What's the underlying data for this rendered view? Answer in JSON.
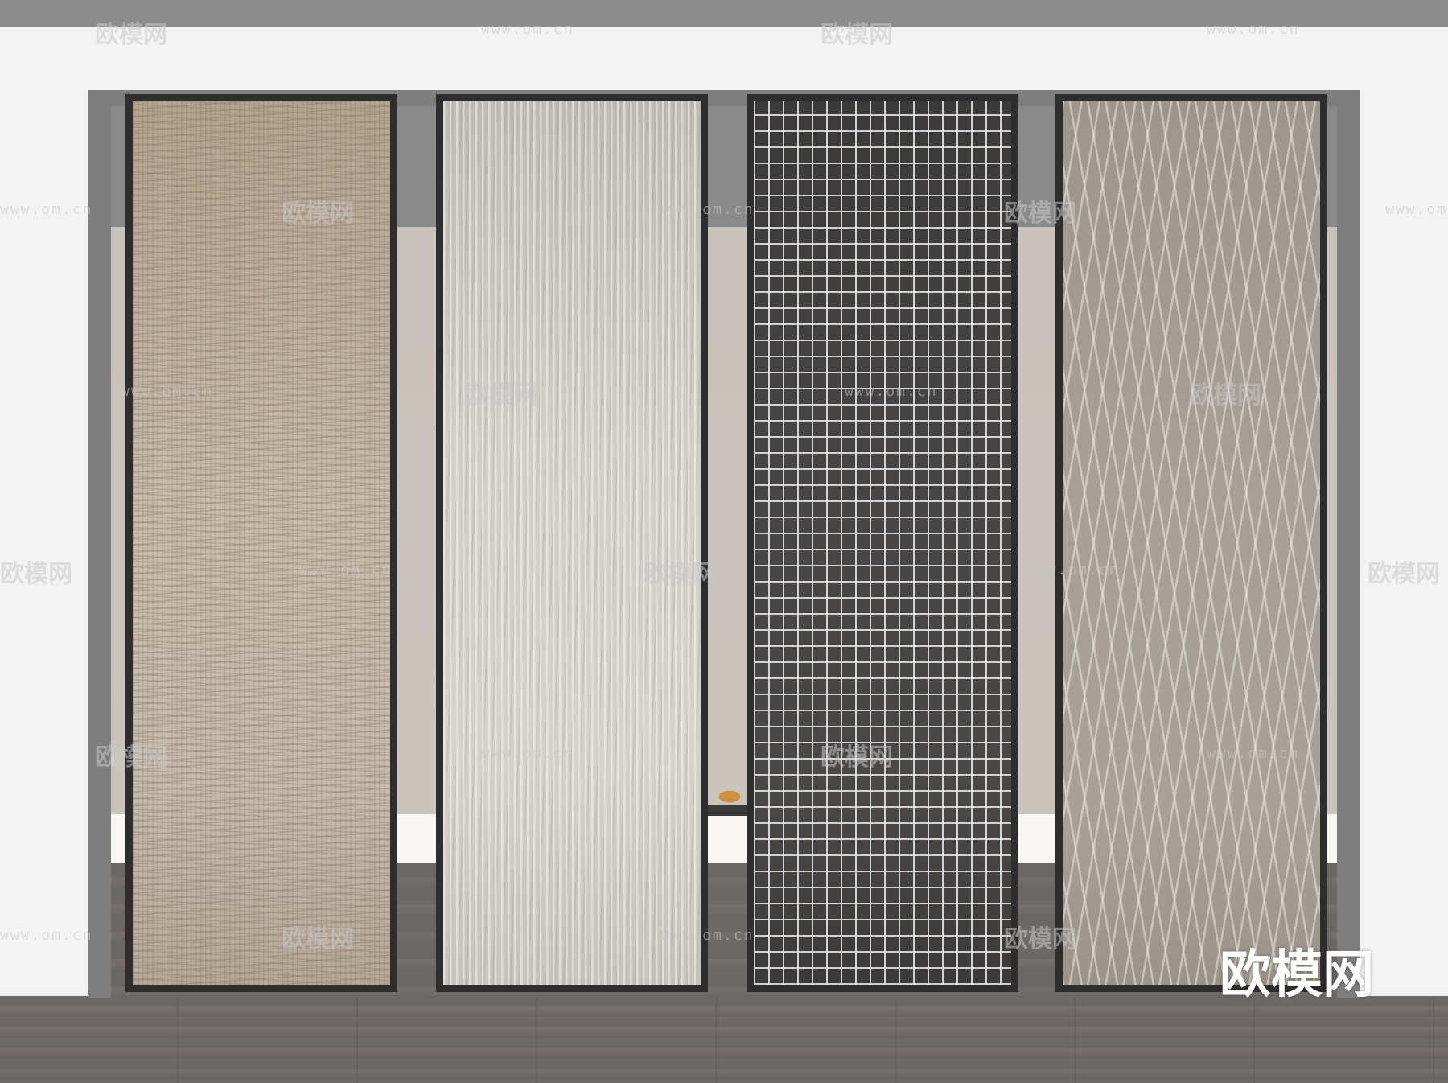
{
  "watermark": {
    "brand": "欧模网",
    "url": "www.om.cn",
    "corner_logo": "欧模网"
  },
  "panels": [
    {
      "name": "panel-1",
      "pattern": "fine-crosshatch",
      "color": "#c0b3a2"
    },
    {
      "name": "panel-2",
      "pattern": "vertical-streaks",
      "color": "#d1cdc7"
    },
    {
      "name": "panel-3",
      "pattern": "grid-mesh",
      "color": "#454341"
    },
    {
      "name": "panel-4",
      "pattern": "wavy-lines",
      "color": "#a59e94"
    }
  ],
  "colors": {
    "frame": "#2e2e2e",
    "wall": "#f3f3f3",
    "floor": "#6e6a68"
  }
}
